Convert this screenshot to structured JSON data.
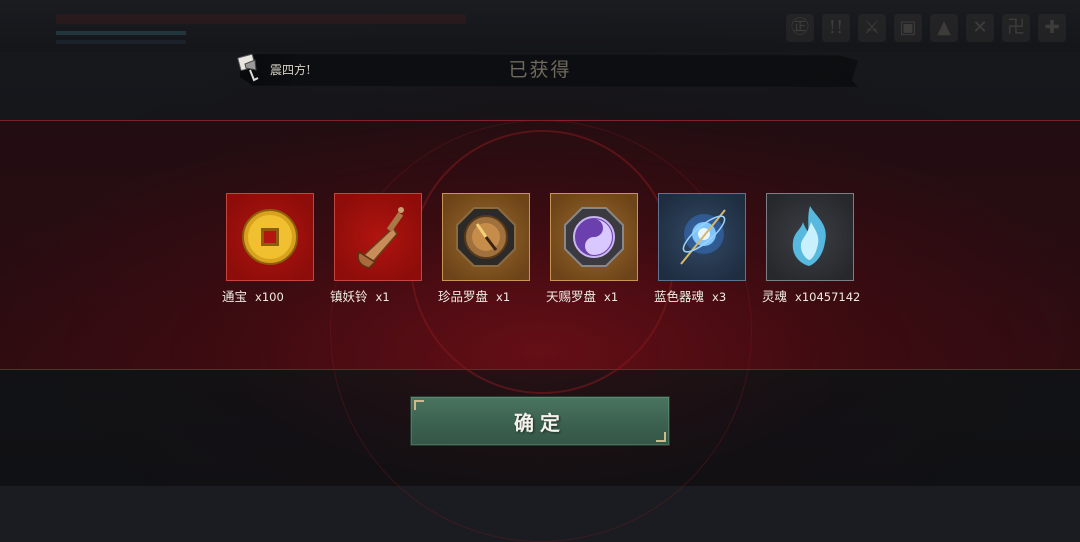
{
  "hud": {
    "skill_icons": [
      "㊣",
      "!!",
      "⚔",
      "▣",
      "▲",
      "✕",
      "卍",
      "✚"
    ]
  },
  "banner": {
    "title": "已获得",
    "announcement": "震四方!"
  },
  "rewards": [
    {
      "name": "通宝",
      "qty": "x100",
      "rarity": "red",
      "icon": "coin-icon"
    },
    {
      "name": "镇妖铃",
      "qty": "x1",
      "rarity": "red",
      "icon": "bell-icon"
    },
    {
      "name": "珍品罗盘",
      "qty": "x1",
      "rarity": "gold",
      "icon": "compass-icon"
    },
    {
      "name": "天赐罗盘",
      "qty": "x1",
      "rarity": "gold",
      "icon": "taiji-compass-icon"
    },
    {
      "name": "蓝色器魂",
      "qty": "x3",
      "rarity": "blue",
      "icon": "blue-soul-orb-icon"
    },
    {
      "name": "灵魂",
      "qty": "x10457142",
      "rarity": "gray",
      "icon": "spirit-flame-icon"
    }
  ],
  "confirm_label": "确定"
}
